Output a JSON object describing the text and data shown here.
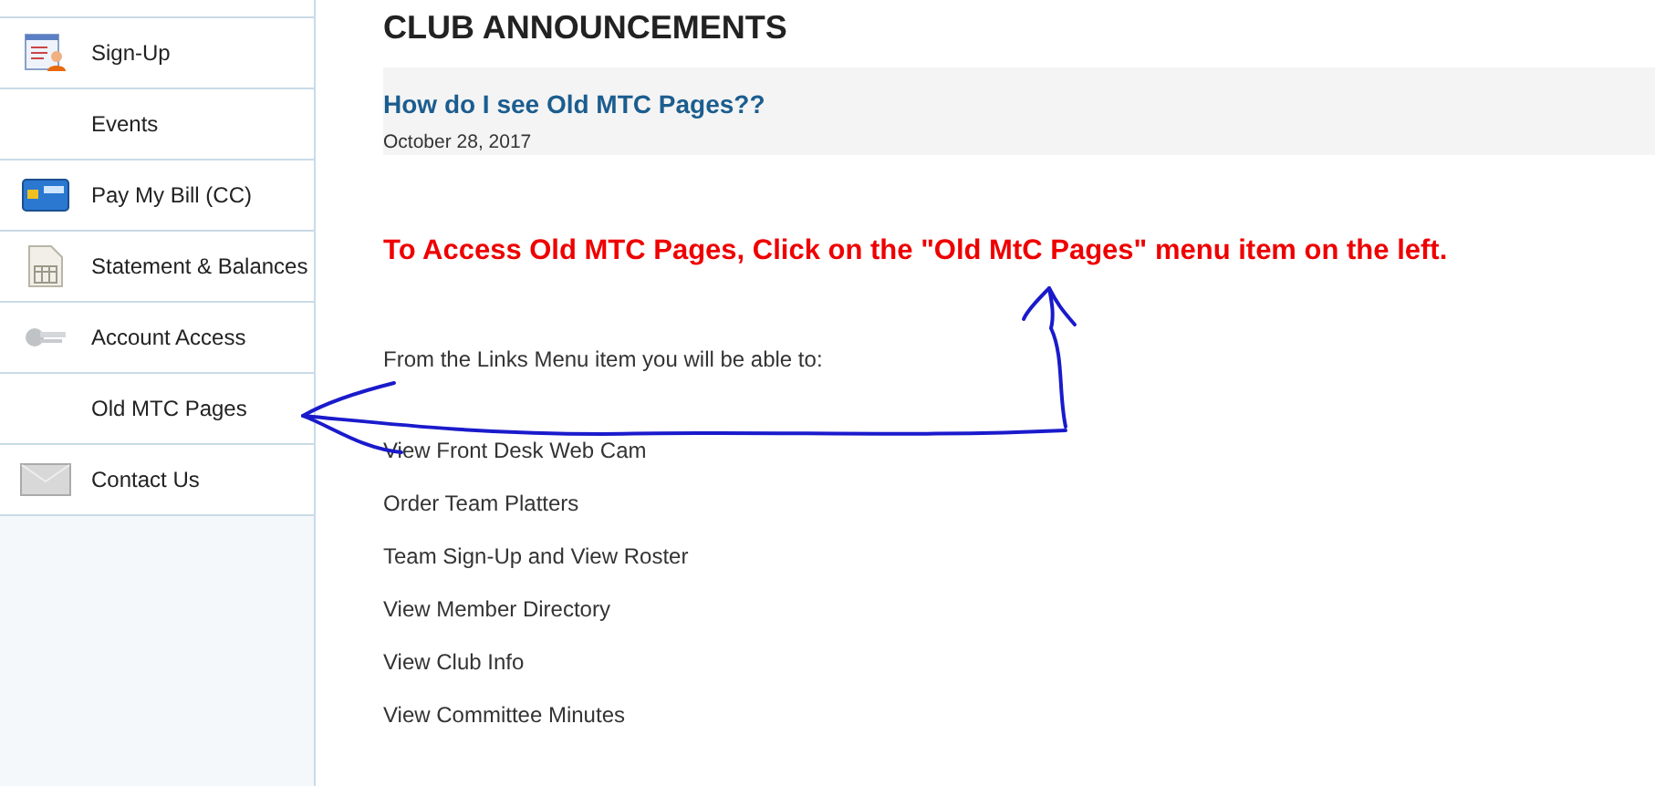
{
  "sidebar": {
    "items": [
      {
        "label": "Sign-Up",
        "kind": "form"
      },
      {
        "label": "Events",
        "kind": "blank"
      },
      {
        "label": "Pay My Bill (CC)",
        "kind": "card"
      },
      {
        "label": "Statement & Balances",
        "kind": "sheet"
      },
      {
        "label": "Account Access",
        "kind": "keys"
      },
      {
        "label": "Old MTC Pages",
        "kind": "blank"
      },
      {
        "label": "Contact Us",
        "kind": "mail"
      }
    ]
  },
  "heading": "CLUB ANNOUNCEMENTS",
  "announcement": {
    "title": "How do I see Old MTC Pages??",
    "date": "October 28, 2017",
    "notice": "To Access Old MTC Pages, Click on the \"Old MtC Pages\" menu item on the left.",
    "intro": "From the Links Menu item you will be able to:",
    "links": [
      "View Front Desk Web Cam",
      "Order Team Platters",
      "Team Sign-Up and View Roster",
      "View Member Directory",
      "View Club Info",
      "View Committee Minutes"
    ]
  }
}
